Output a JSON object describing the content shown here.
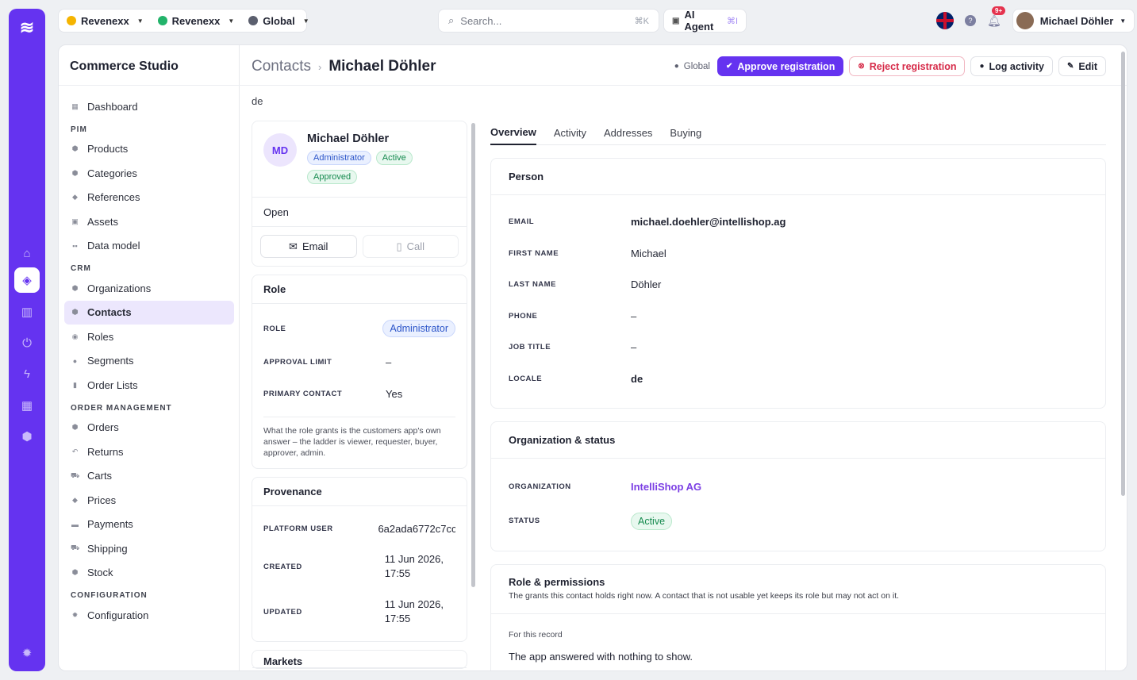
{
  "topbar": {
    "contexts": [
      {
        "label": "Revenexx",
        "color": "#f5b400"
      },
      {
        "label": "Revenexx",
        "color": "#22b36a"
      },
      {
        "label": "Global",
        "color": "#5b5f6e"
      }
    ],
    "search_placeholder": "Search...",
    "search_shortcut": "⌘K",
    "agent_label": "AI Agent",
    "agent_shortcut": "⌘I",
    "notifications_badge": "9+",
    "user_name": "Michael Döhler"
  },
  "sidebar": {
    "title": "Commerce Studio",
    "items": [
      {
        "type": "item",
        "label": "Dashboard",
        "icon": "dashboard-icon"
      },
      {
        "type": "group",
        "label": "PIM"
      },
      {
        "type": "item",
        "label": "Products",
        "icon": "cube-icon"
      },
      {
        "type": "item",
        "label": "Categories",
        "icon": "cube-icon"
      },
      {
        "type": "item",
        "label": "References",
        "icon": "tag-icon"
      },
      {
        "type": "item",
        "label": "Assets",
        "icon": "image-icon"
      },
      {
        "type": "item",
        "label": "Data model",
        "icon": "grid-icon"
      },
      {
        "type": "group",
        "label": "CRM"
      },
      {
        "type": "item",
        "label": "Organizations",
        "icon": "building-icon"
      },
      {
        "type": "item",
        "label": "Contacts",
        "icon": "contact-icon",
        "active": true
      },
      {
        "type": "item",
        "label": "Roles",
        "icon": "shield-icon"
      },
      {
        "type": "item",
        "label": "Segments",
        "icon": "people-icon"
      },
      {
        "type": "item",
        "label": "Order Lists",
        "icon": "list-icon"
      },
      {
        "type": "group",
        "label": "ORDER MANAGEMENT"
      },
      {
        "type": "item",
        "label": "Orders",
        "icon": "box-icon"
      },
      {
        "type": "item",
        "label": "Returns",
        "icon": "return-icon"
      },
      {
        "type": "item",
        "label": "Carts",
        "icon": "cart-icon"
      },
      {
        "type": "item",
        "label": "Prices",
        "icon": "price-tag-icon"
      },
      {
        "type": "item",
        "label": "Payments",
        "icon": "card-icon"
      },
      {
        "type": "item",
        "label": "Shipping",
        "icon": "truck-icon"
      },
      {
        "type": "item",
        "label": "Stock",
        "icon": "cube-icon"
      },
      {
        "type": "group",
        "label": "CONFIGURATION"
      },
      {
        "type": "item",
        "label": "Configuration",
        "icon": "gear-icon"
      }
    ]
  },
  "header": {
    "crumb_parent": "Contacts",
    "crumb_current": "Michael Döhler",
    "scope_label": "Global",
    "approve_label": "Approve registration",
    "reject_label": "Reject registration",
    "log_label": "Log activity",
    "edit_label": "Edit",
    "locale": "de"
  },
  "profile": {
    "initials": "MD",
    "name": "Michael Döhler",
    "chip_role": "Administrator",
    "chip_active": "Active",
    "chip_approved": "Approved",
    "state": "Open",
    "email_label": "Email",
    "call_label": "Call"
  },
  "role_card": {
    "title": "Role",
    "role_key": "ROLE",
    "role_value": "Administrator",
    "limit_key": "APPROVAL LIMIT",
    "limit_value": "–",
    "primary_key": "PRIMARY CONTACT",
    "primary_value": "Yes",
    "note": "What the role grants is the customers app's own answer – the ladder is viewer, requester, buyer, approver, admin."
  },
  "provenance": {
    "title": "Provenance",
    "user_key": "PLATFORM USER",
    "user_value": "6a2ada6772c7cc",
    "created_key": "CREATED",
    "created_value": "11 Jun 2026, 17:55",
    "updated_key": "UPDATED",
    "updated_value": "11 Jun 2026, 17:55",
    "markets_title": "Markets"
  },
  "tabs": [
    "Overview",
    "Activity",
    "Addresses",
    "Buying"
  ],
  "person": {
    "title": "Person",
    "rows": [
      {
        "k": "EMAIL",
        "v": "michael.doehler@intellishop.ag"
      },
      {
        "k": "FIRST NAME",
        "v": "Michael"
      },
      {
        "k": "LAST NAME",
        "v": "Döhler"
      },
      {
        "k": "PHONE",
        "v": "–"
      },
      {
        "k": "JOB TITLE",
        "v": "–"
      },
      {
        "k": "LOCALE",
        "v": "de"
      }
    ]
  },
  "org": {
    "title": "Organization & status",
    "org_key": "ORGANIZATION",
    "org_value": "IntelliShop AG",
    "status_key": "STATUS",
    "status_value": "Active"
  },
  "permissions": {
    "title": "Role & permissions",
    "subtitle": "The grants this contact holds right now. A contact that is not usable yet keeps its role but may not act on it.",
    "record_label": "For this record",
    "message": "The app answered with nothing to show."
  }
}
